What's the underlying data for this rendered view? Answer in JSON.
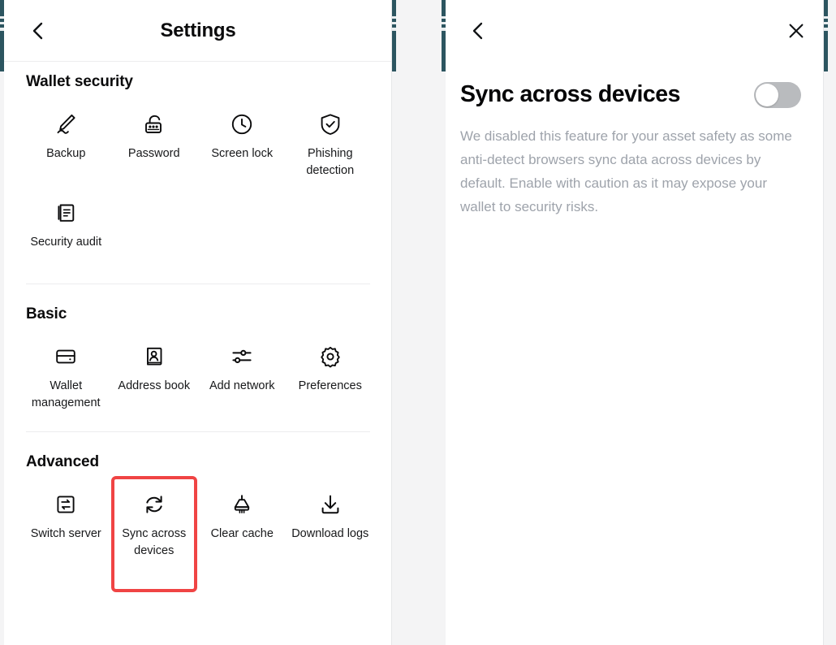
{
  "colors": {
    "accent_highlight": "#f04444",
    "background": "#f4f4f5",
    "panel": "#ffffff",
    "text_primary": "#0b0b0c",
    "text_muted": "#9ea3ab",
    "toggle_off": "#b9bbbe",
    "bg_sliver": "#2c5560"
  },
  "settings_panel": {
    "header": {
      "back_icon": "chevron-left-icon",
      "title": "Settings"
    },
    "sections": [
      {
        "id": "wallet-security",
        "title": "Wallet security",
        "items": [
          {
            "label": "Backup",
            "icon": "pencil-signature-icon",
            "highlight": false
          },
          {
            "label": "Password",
            "icon": "unlocked-padlock-asterisk-icon",
            "highlight": false
          },
          {
            "label": "Screen lock",
            "icon": "clock-icon",
            "highlight": false
          },
          {
            "label": "Phishing detection",
            "icon": "shield-check-icon",
            "highlight": false
          },
          {
            "label": "Security audit",
            "icon": "document-lines-icon",
            "highlight": false
          }
        ]
      },
      {
        "id": "basic",
        "title": "Basic",
        "items": [
          {
            "label": "Wallet management",
            "icon": "wallet-card-icon",
            "highlight": false
          },
          {
            "label": "Address book",
            "icon": "contact-person-icon",
            "highlight": false
          },
          {
            "label": "Add network",
            "icon": "sliders-icon",
            "highlight": false
          },
          {
            "label": "Preferences",
            "icon": "gear-icon",
            "highlight": false
          }
        ]
      },
      {
        "id": "advanced",
        "title": "Advanced",
        "items": [
          {
            "label": "Switch server",
            "icon": "switch-arrows-square-icon",
            "highlight": false
          },
          {
            "label": "Sync across devices",
            "icon": "sync-circular-arrows-icon",
            "highlight": true
          },
          {
            "label": "Clear cache",
            "icon": "broom-icon",
            "highlight": false
          },
          {
            "label": "Download logs",
            "icon": "download-arrow-icon",
            "highlight": false
          }
        ]
      }
    ]
  },
  "detail_panel": {
    "header": {
      "back_icon": "chevron-left-icon",
      "close_icon": "close-x-icon"
    },
    "title": "Sync across devices",
    "toggle": {
      "name": "sync-across-devices-toggle",
      "state": "off",
      "state_label": "off"
    },
    "description": "We disabled this feature for your asset safety as some anti-detect browsers sync data across devices by default. Enable with caution as it may expose your wallet to security risks."
  }
}
